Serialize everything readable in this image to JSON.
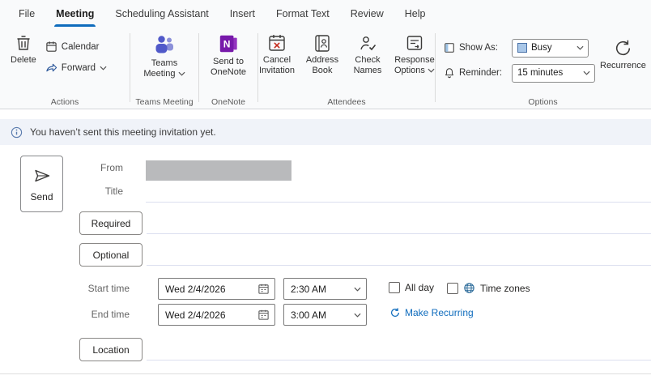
{
  "tabs": [
    {
      "label": "File"
    },
    {
      "label": "Meeting"
    },
    {
      "label": "Scheduling Assistant"
    },
    {
      "label": "Insert"
    },
    {
      "label": "Format Text"
    },
    {
      "label": "Review"
    },
    {
      "label": "Help"
    }
  ],
  "active_tab": "Meeting",
  "ribbon": {
    "actions": {
      "delete": "Delete",
      "calendar": "Calendar",
      "forward": "Forward",
      "group": "Actions"
    },
    "teams_meeting": {
      "button": "Teams Meeting",
      "group": "Teams Meeting"
    },
    "onenote": {
      "button": "Send to OneNote",
      "group": "OneNote"
    },
    "attendees": {
      "cancel_invitation": "Cancel Invitation",
      "address_book": "Address Book",
      "check_names": "Check Names",
      "response_options": "Response Options",
      "group": "Attendees"
    },
    "options": {
      "show_as_label": "Show As:",
      "show_as_value": "Busy",
      "reminder_label": "Reminder:",
      "reminder_value": "15 minutes",
      "recurrence": "Recurrence",
      "group": "Options"
    }
  },
  "infobar": {
    "message": "You haven’t sent this meeting invitation yet."
  },
  "form": {
    "send": "Send",
    "from_label": "From",
    "title_label": "Title",
    "title_value": "",
    "required": "Required",
    "required_value": "",
    "optional": "Optional",
    "optional_value": "",
    "start_time_label": "Start time",
    "start_date": "Wed 2/4/2026",
    "start_time": "2:30 AM",
    "end_time_label": "End time",
    "end_date": "Wed 2/4/2026",
    "end_time": "3:00 AM",
    "all_day": "All day",
    "all_day_checked": false,
    "time_zones": "Time zones",
    "time_zones_checked": false,
    "make_recurring": "Make Recurring",
    "location": "Location",
    "location_value": ""
  },
  "icons": {
    "delete": "trash-icon",
    "calendar": "calendar-icon",
    "forward": "forward-arrow-icon",
    "teams": "teams-people-icon",
    "onenote": "onenote-n-icon",
    "cancel_invitation": "calendar-x-icon",
    "address_book": "address-book-icon",
    "check_names": "person-check-icon",
    "response_options": "list-reply-icon",
    "show_as": "status-square-icon",
    "reminder": "bell-icon",
    "recurrence": "circular-arrows-icon",
    "send": "paper-plane-icon",
    "info": "info-circle-icon",
    "date_picker": "calendar-picker-icon",
    "time_zones": "globe-icon",
    "make_recurring": "circular-arrows-icon",
    "dropdown": "chevron-down-icon"
  },
  "colors": {
    "accent": "#0f6cbd",
    "link": "#0f6cbd",
    "teams_purple": "#5059c9",
    "teams_purple_light": "#8b90d9",
    "onenote_purple": "#7719aa",
    "busy_fill": "#a9c7e8",
    "busy_border": "#4a72a8",
    "cancel_red": "#c42b1c",
    "infobar_bg": "#f0f3f9",
    "ribbon_bg": "#f9fafb"
  }
}
